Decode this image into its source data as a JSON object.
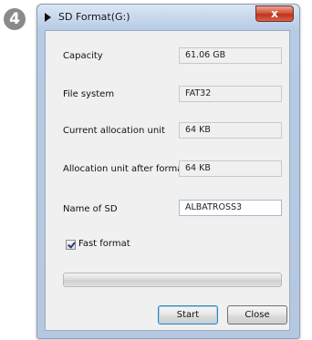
{
  "step_number": "4",
  "window": {
    "title": "SD Format(G:)",
    "close_label": "x"
  },
  "fields": [
    {
      "label": "Capacity",
      "value": "61.06 GB"
    },
    {
      "label": "File system",
      "value": "FAT32"
    },
    {
      "label": "Current allocation unit",
      "value": "64 KB"
    },
    {
      "label": "Allocation unit after format",
      "value": "64 KB"
    },
    {
      "label": "Name of SD",
      "value": "ALBATROSS3"
    }
  ],
  "fast_format": {
    "label": "Fast format",
    "checked": true
  },
  "buttons": {
    "start": "Start",
    "close": "Close"
  }
}
